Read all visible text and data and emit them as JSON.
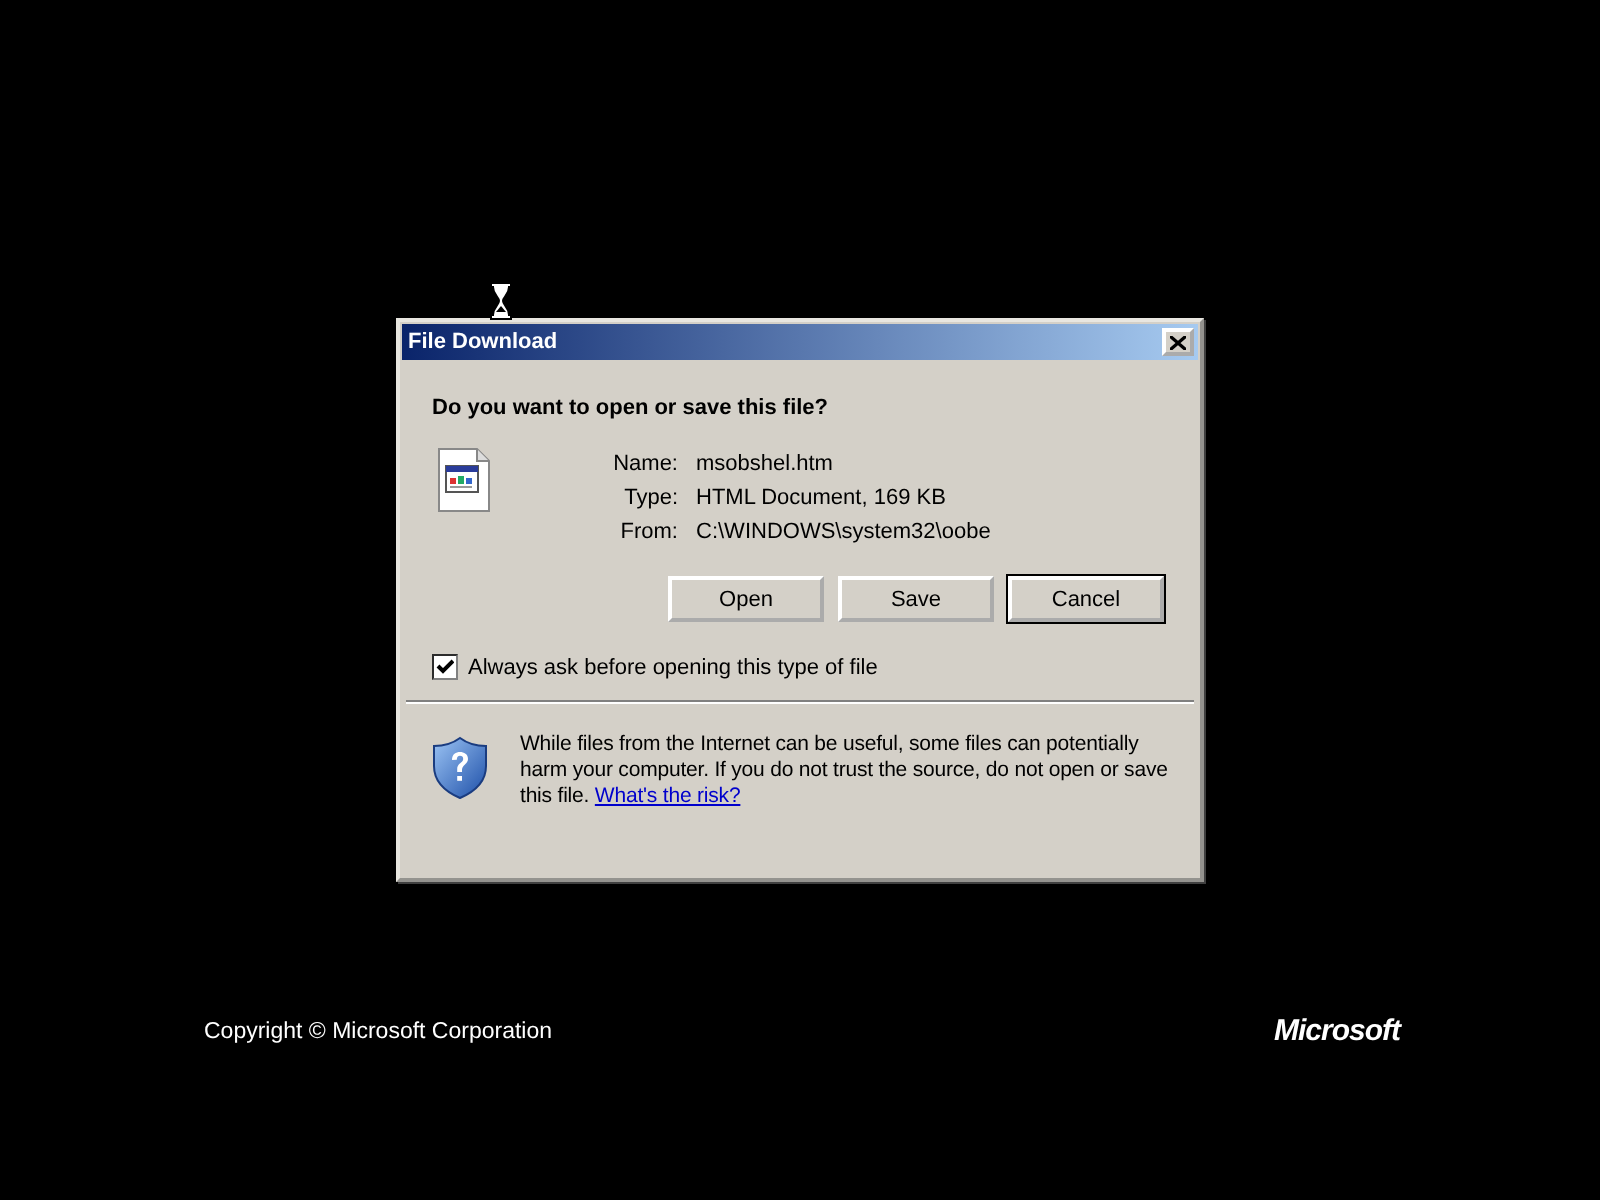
{
  "dialog": {
    "title": "File Download",
    "question": "Do you want to open or save this file?",
    "fields": [
      {
        "label": "Name:",
        "value": "msobshel.htm"
      },
      {
        "label": "Type:",
        "value": "HTML Document, 169 KB"
      },
      {
        "label": "From:",
        "value": "C:\\WINDOWS\\system32\\oobe"
      }
    ],
    "buttons": [
      {
        "label": "Open",
        "default": false
      },
      {
        "label": "Save",
        "default": false
      },
      {
        "label": "Cancel",
        "default": true
      }
    ],
    "always_ask": {
      "label": "Always ask before opening this type of file",
      "checked": true
    },
    "warning": {
      "text": "While files from the Internet can be useful, some files can potentially harm your computer. If you do not trust the source, do not open or save this file.",
      "link": "What's the risk?"
    }
  },
  "footer": {
    "copyright": "Copyright © Microsoft Corporation",
    "logo": "Microsoft"
  }
}
